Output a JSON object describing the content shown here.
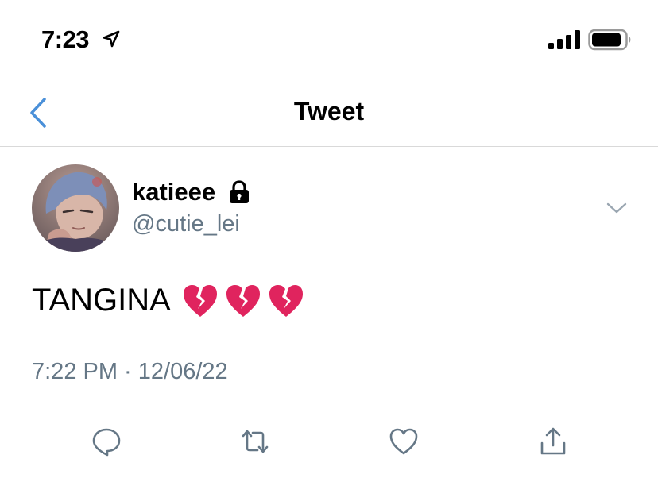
{
  "status_bar": {
    "time": "7:23",
    "location_icon": "location-arrow-icon",
    "signal_icon": "cellular-signal-icon",
    "battery_icon": "battery-icon"
  },
  "nav": {
    "title": "Tweet",
    "back_icon": "chevron-left-icon"
  },
  "tweet": {
    "display_name": "katieee",
    "protected_icon": "lock-icon",
    "handle": "@cutie_lei",
    "text": "TANGINA",
    "emoji": [
      "broken-heart",
      "broken-heart",
      "broken-heart"
    ],
    "timestamp": "7:22 PM · 12/06/22",
    "more_icon": "chevron-down-icon"
  },
  "actions": [
    {
      "name": "reply",
      "icon": "reply-icon"
    },
    {
      "name": "retweet",
      "icon": "retweet-icon"
    },
    {
      "name": "like",
      "icon": "heart-icon"
    },
    {
      "name": "share",
      "icon": "share-icon"
    }
  ],
  "colors": {
    "accent": "#4a90d9",
    "secondary_text": "#657786",
    "icon": "#657786",
    "divider": "#e1e8ed",
    "broken_heart": "#e0245e"
  }
}
